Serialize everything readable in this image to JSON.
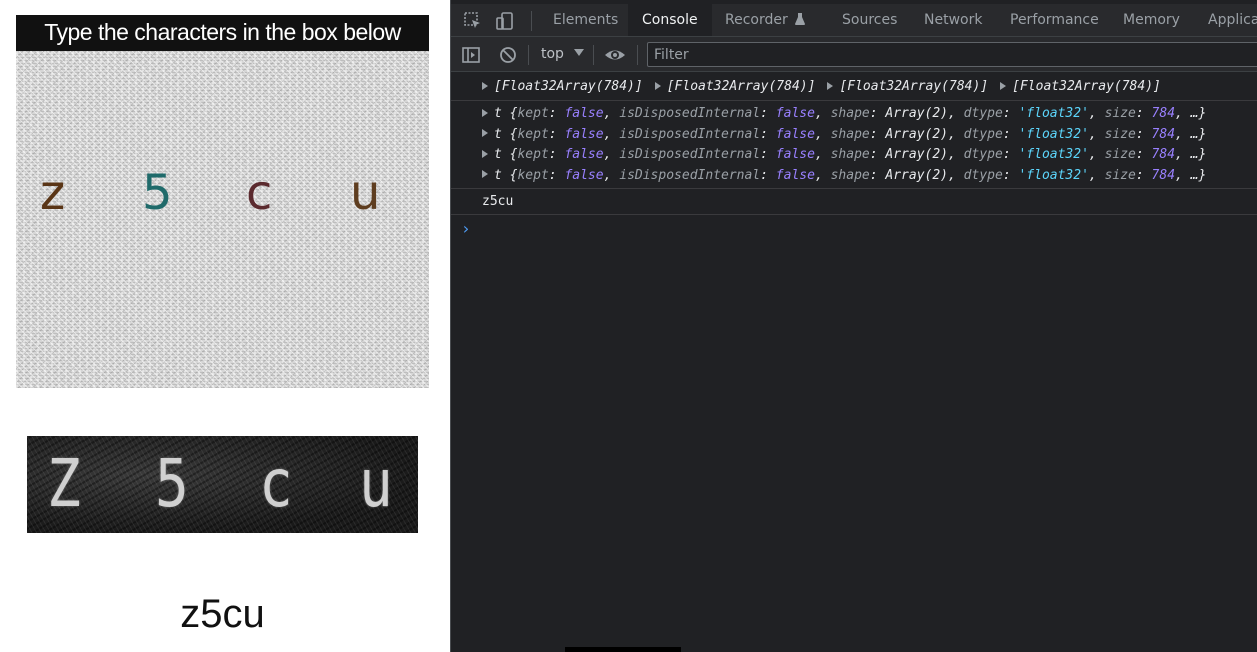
{
  "page": {
    "captcha_header": "Type the characters in the box below",
    "captcha_chars": [
      {
        "char": "z",
        "color": "#5a3516"
      },
      {
        "char": "5",
        "color": "#1f6a6a"
      },
      {
        "char": "c",
        "color": "#5b2a2e"
      },
      {
        "char": "u",
        "color": "#5e3d1f"
      }
    ],
    "processed_chars": [
      "Z",
      "5",
      "c",
      "u"
    ],
    "result_text": "z5cu"
  },
  "devtools": {
    "tabs": [
      "Elements",
      "Console",
      "Recorder",
      "Sources",
      "Network",
      "Performance",
      "Memory",
      "Applicat"
    ],
    "active_tab": "Console",
    "recorder_badge_icon": "flask-icon",
    "context_label": "top",
    "filter_placeholder": "Filter",
    "console": {
      "array_items": [
        "[Float32Array(784)]",
        "[Float32Array(784)]",
        "[Float32Array(784)]",
        "[Float32Array(784)]"
      ],
      "tensor_rows": [
        {
          "prefix": "t {",
          "kept_key": "kept",
          "kept_val": "false",
          "disposed_key": "isDisposedInternal",
          "disposed_val": "false",
          "shape_key": "shape",
          "shape_val": "Array(2)",
          "dtype_key": "dtype",
          "dtype_val": "'float32'",
          "size_key": "size",
          "size_val": "784",
          "suffix": ", …}"
        },
        {
          "prefix": "t {",
          "kept_key": "kept",
          "kept_val": "false",
          "disposed_key": "isDisposedInternal",
          "disposed_val": "false",
          "shape_key": "shape",
          "shape_val": "Array(2)",
          "dtype_key": "dtype",
          "dtype_val": "'float32'",
          "size_key": "size",
          "size_val": "784",
          "suffix": ", …}"
        },
        {
          "prefix": "t {",
          "kept_key": "kept",
          "kept_val": "false",
          "disposed_key": "isDisposedInternal",
          "disposed_val": "false",
          "shape_key": "shape",
          "shape_val": "Array(2)",
          "dtype_key": "dtype",
          "dtype_val": "'float32'",
          "size_key": "size",
          "size_val": "784",
          "suffix": ", …}"
        },
        {
          "prefix": "t {",
          "kept_key": "kept",
          "kept_val": "false",
          "disposed_key": "isDisposedInternal",
          "disposed_val": "false",
          "shape_key": "shape",
          "shape_val": "Array(2)",
          "dtype_key": "dtype",
          "dtype_val": "'float32'",
          "size_key": "size",
          "size_val": "784",
          "suffix": ", …}"
        }
      ],
      "log_output": "z5cu",
      "prompt_symbol": "›"
    }
  }
}
